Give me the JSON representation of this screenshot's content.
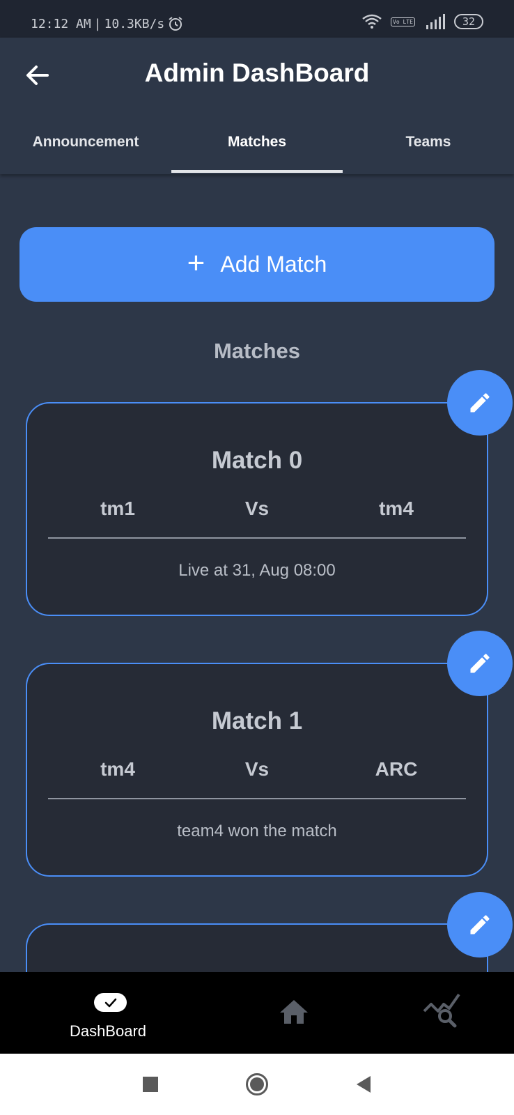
{
  "status_bar": {
    "time": "12:12 AM",
    "separator": "|",
    "network_speed": "10.3KB/s",
    "battery": "32",
    "volte": "Vo LTE",
    "icons": [
      "alarm-icon",
      "wifi-icon",
      "volte-icon",
      "signal-icon",
      "battery-icon"
    ]
  },
  "app_bar": {
    "title": "Admin DashBoard",
    "back_icon": "arrow-left-icon"
  },
  "tabs": [
    {
      "label": "Announcement",
      "active": false
    },
    {
      "label": "Matches",
      "active": true
    },
    {
      "label": "Teams",
      "active": false
    }
  ],
  "add_button": {
    "icon": "plus-icon",
    "plus": "+",
    "label": "Add Match"
  },
  "section_title": "Matches",
  "matches": [
    {
      "title": "Match 0",
      "team1": "tm1",
      "vs": "Vs",
      "team2": "tm4",
      "status": "Live at 31, Aug 08:00"
    },
    {
      "title": "Match 1",
      "team1": "tm4",
      "vs": "Vs",
      "team2": "ARC",
      "status": "team4 won the match"
    }
  ],
  "bottom_nav": {
    "items": [
      {
        "label": "DashBoard",
        "icon": "toggle-check-icon",
        "active": true
      },
      {
        "label": "",
        "icon": "home-icon"
      },
      {
        "label": "",
        "icon": "analytics-search-icon"
      }
    ]
  },
  "system_nav": [
    "square-recents-icon",
    "circle-home-icon",
    "triangle-back-icon"
  ],
  "colors": {
    "background": "#2d3748",
    "card": "#262b36",
    "accent": "#4a8ef7",
    "status_bar": "#1f2531",
    "bottom_nav": "#000000"
  }
}
